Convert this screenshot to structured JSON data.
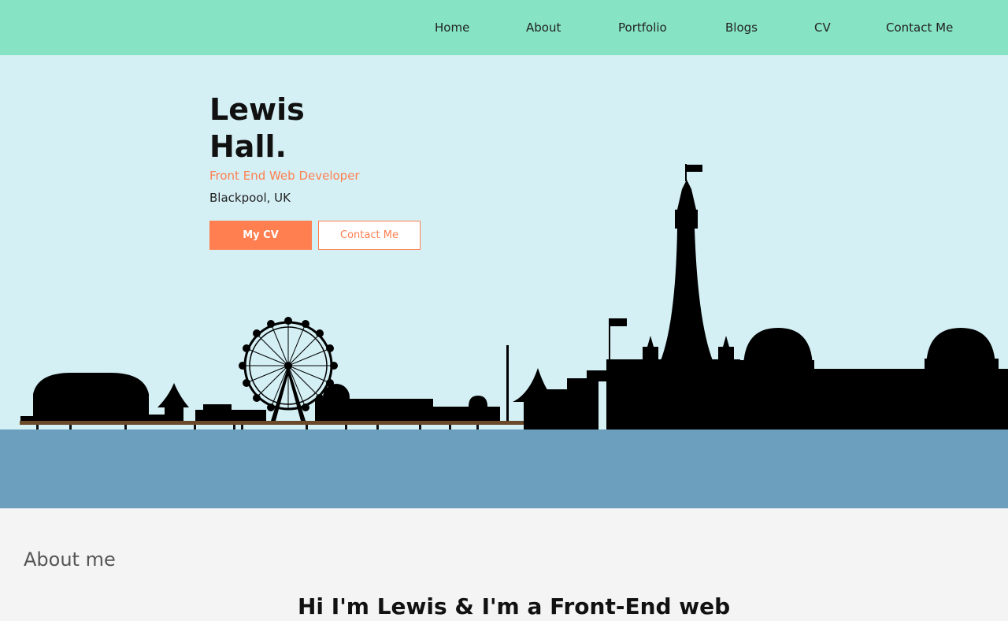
{
  "nav": {
    "items": [
      {
        "label": "Home"
      },
      {
        "label": "About"
      },
      {
        "label": "Portfolio"
      },
      {
        "label": "Blogs"
      },
      {
        "label": "CV"
      },
      {
        "label": "Contact Me"
      }
    ]
  },
  "hero": {
    "name_first": "Lewis",
    "name_last": "Hall.",
    "role": "Front End Web Developer",
    "location": "Blackpool, UK",
    "primary_button": "My CV",
    "secondary_button": "Contact Me"
  },
  "about": {
    "heading": "About me",
    "intro": "Hi I'm Lewis & I'm a Front-End web"
  },
  "colors": {
    "nav_bg": "#86e3c4",
    "sky": "#d4f0f5",
    "water": "#6c9ebd",
    "accent": "#ff7f50",
    "page_bg": "#f4f4f4"
  }
}
